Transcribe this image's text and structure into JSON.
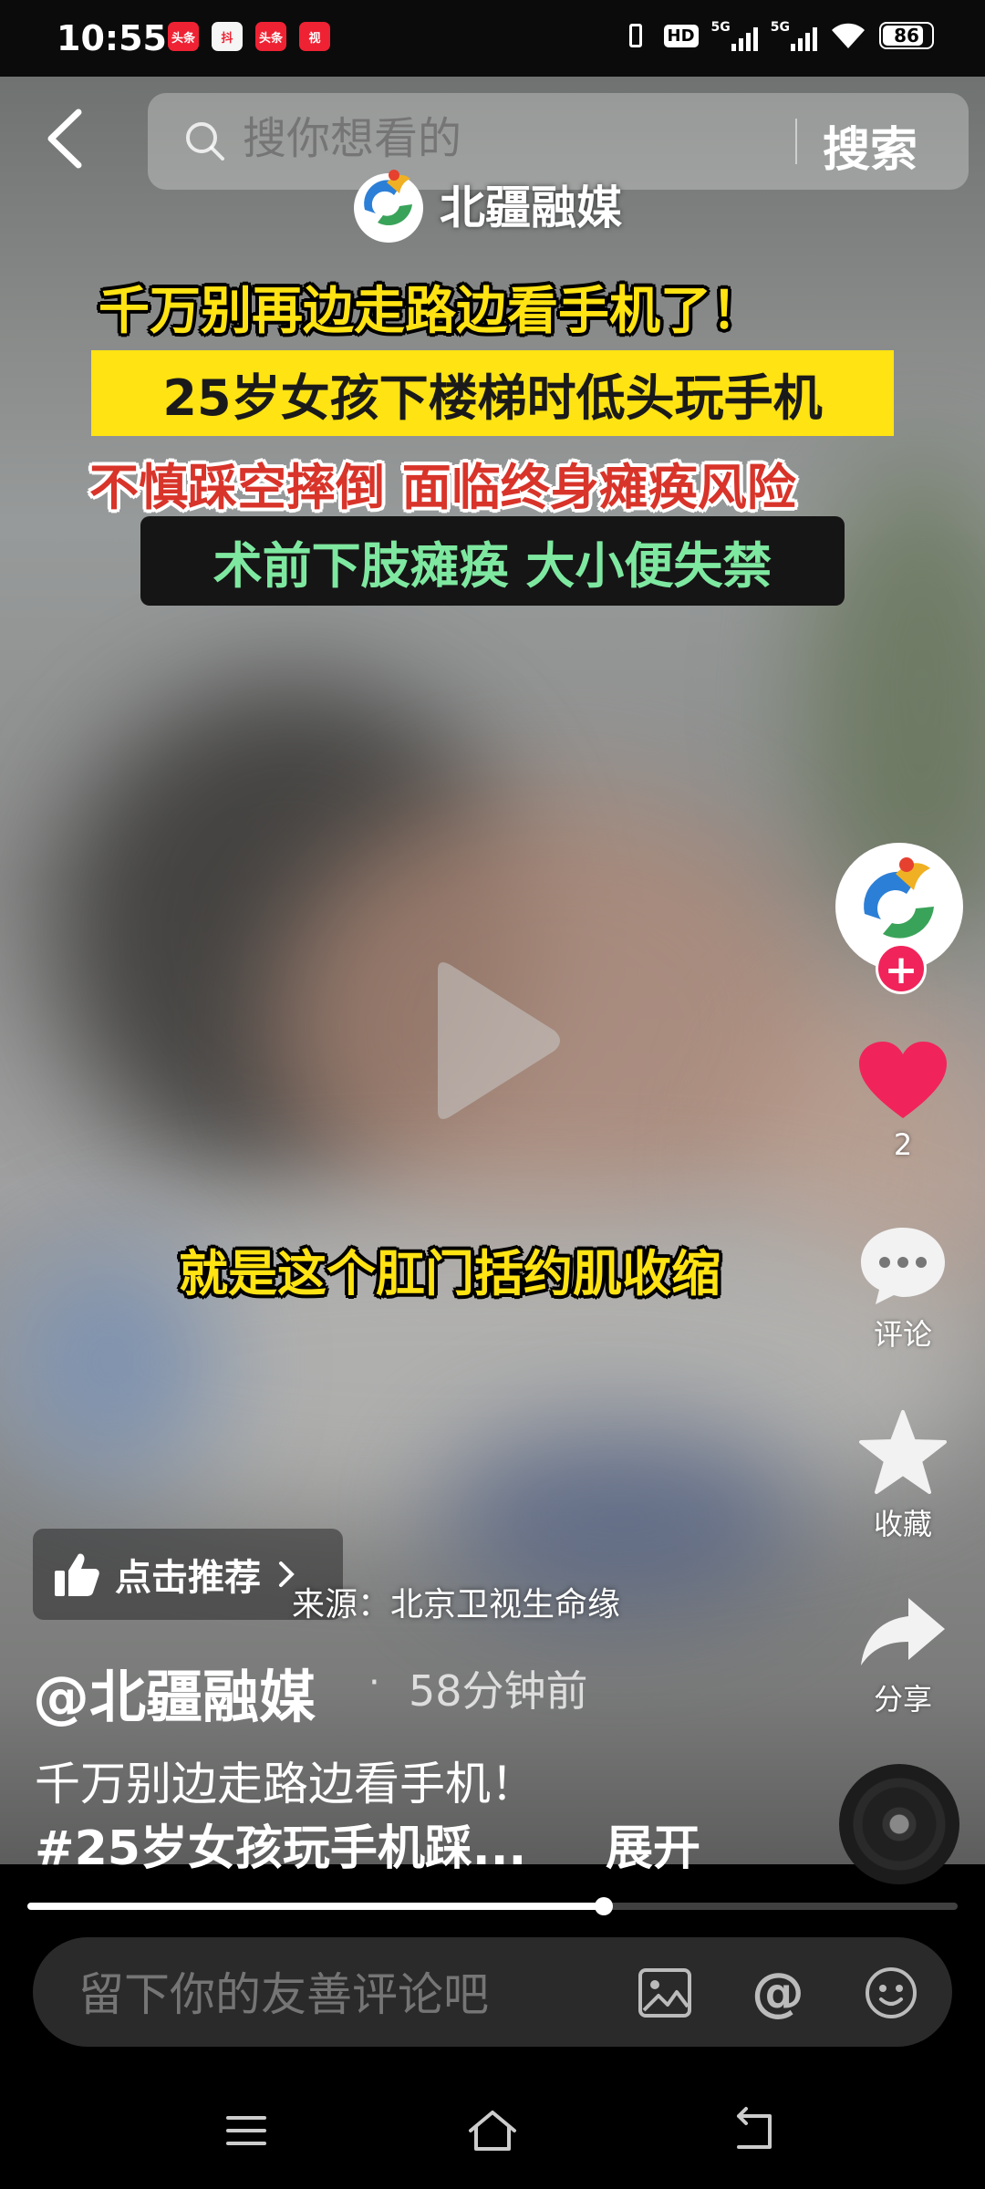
{
  "status_bar": {
    "time": "10:55",
    "app_icons": [
      "头条",
      "抖",
      "头条",
      "视"
    ],
    "hd_label": "HD",
    "network1": "5G",
    "network2": "5G",
    "battery": "86",
    "battery_level": 0.86
  },
  "header": {
    "search_placeholder": "搜你想看的",
    "search_button": "搜索"
  },
  "video": {
    "brand_name": "北疆融媒",
    "caption_line1": "千万别再边走路边看手机了！",
    "caption_line2": "25岁女孩下楼梯时低头玩手机",
    "caption_line3": "不慎踩空摔倒  面临终身瘫痪风险",
    "caption_line4": "术前下肢瘫痪  大小便失禁",
    "subtitle": "就是这个肛门括约肌收缩",
    "source": "来源：北京卫视生命缘"
  },
  "actions": {
    "like_count": "2",
    "comment_label": "评论",
    "favorite_label": "收藏",
    "share_label": "分享",
    "follow_symbol": "+"
  },
  "post": {
    "recommend_label": "点击推荐",
    "author": "@北疆融媒",
    "separator": "·",
    "time_ago": "58分钟前",
    "description_line1": "千万别边走路边看手机！",
    "description_line2": "#25岁女孩玩手机踩...",
    "expand_label": "展开"
  },
  "progress": {
    "fraction": 0.62
  },
  "comment_bar": {
    "placeholder": "留下你的友善评论吧",
    "at_symbol": "@"
  },
  "colors": {
    "caption_yellow": "#ffe313",
    "caption_red": "#d8342a",
    "caption_green": "#7ee8a0",
    "like_red": "#f0245a"
  },
  "icons": [
    "back-arrow-icon",
    "search-icon",
    "play-icon",
    "heart-icon",
    "comment-icon",
    "star-icon",
    "share-icon",
    "thumbs-up-icon",
    "chevron-right-icon",
    "image-icon",
    "emoji-icon",
    "menu-icon",
    "home-icon",
    "back-icon"
  ]
}
